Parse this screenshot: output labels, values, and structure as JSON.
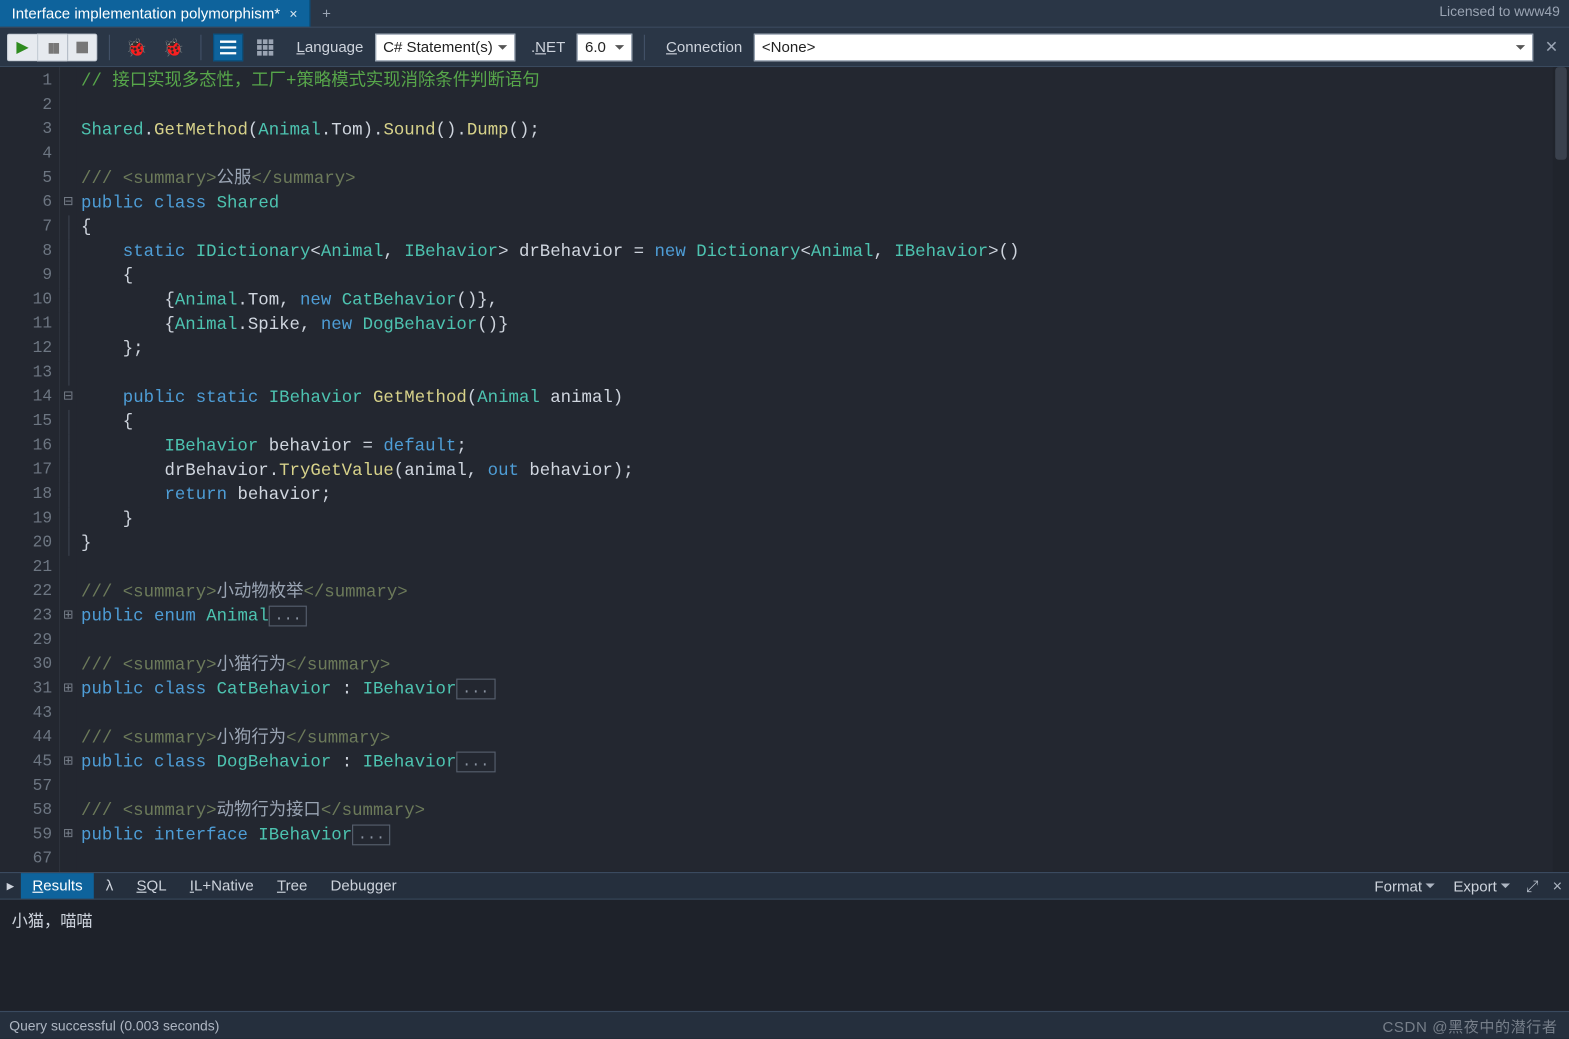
{
  "header": {
    "tab_title": "Interface implementation polymorphism*",
    "license_text": "Licensed to www49"
  },
  "toolbar": {
    "language_label": "Language",
    "language_value": "C# Statement(s)",
    "net_label": ".NET",
    "net_value": "6.0",
    "connection_label": "Connection",
    "connection_value": "<None>"
  },
  "editor": {
    "line_numbers": [
      "1",
      "2",
      "3",
      "4",
      "5",
      "6",
      "7",
      "8",
      "9",
      "10",
      "11",
      "12",
      "13",
      "14",
      "15",
      "16",
      "17",
      "18",
      "19",
      "20",
      "21",
      "22",
      "23",
      "29",
      "30",
      "31",
      "43",
      "44",
      "45",
      "57",
      "58",
      "59",
      "67"
    ],
    "folds": [
      "",
      "",
      "",
      "",
      "",
      "-",
      "",
      "",
      "",
      "",
      "",
      "",
      "",
      "-",
      "",
      "",
      "",
      "",
      "",
      "",
      "",
      "",
      "+",
      "",
      "",
      "+",
      "",
      "",
      "+",
      "",
      "",
      "+",
      ""
    ],
    "l1_comment": "// 接口实现多态性，工厂+策略模式实现消除条件判断语句",
    "l5_doc_cn": "公服",
    "l22_doc_cn": "小动物枚举",
    "l30_doc_cn": "小猫行为",
    "l44_doc_cn": "小狗行为",
    "l58_doc_cn": "动物行为接口",
    "kw": {
      "public": "public",
      "class": "class",
      "static": "static",
      "new": "new",
      "enum": "enum",
      "interface": "interface",
      "return": "return",
      "out": "out",
      "default": "default"
    },
    "ty": {
      "Shared": "Shared",
      "IDictionary": "IDictionary",
      "Animal": "Animal",
      "IBehavior": "IBehavior",
      "Dictionary": "Dictionary",
      "CatBehavior": "CatBehavior",
      "DogBehavior": "DogBehavior"
    },
    "id": {
      "drBehavior": "drBehavior",
      "behavior": "behavior",
      "animal": "animal",
      "Tom": "Tom",
      "Spike": "Spike",
      "GetMethod": "GetMethod",
      "Sound": "Sound",
      "Dump": "Dump",
      "TryGetValue": "TryGetValue"
    },
    "collapsed": "..."
  },
  "resultsbar": {
    "tabs": {
      "results": "Results",
      "sql": "SQL",
      "ilnative": "IL+Native",
      "tree": "Tree",
      "debugger": "Debugger"
    },
    "lambda": "λ",
    "format": "Format",
    "export": "Export"
  },
  "output": {
    "text": "小猫，喵喵"
  },
  "status": {
    "text": "Query successful  (0.003 seconds)"
  },
  "watermark": "CSDN @黑夜中的潜行者"
}
